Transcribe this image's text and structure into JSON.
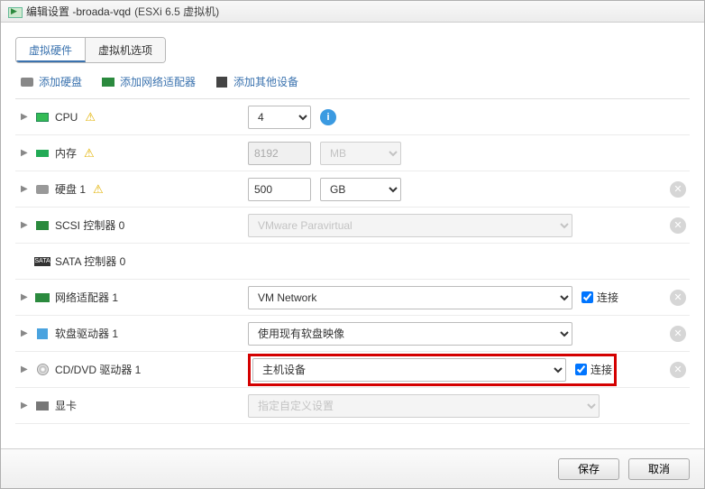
{
  "title": {
    "prefix": "编辑设置 - ",
    "vm": "broada-vqd",
    "suffix": "(ESXi 6.5 虚拟机)"
  },
  "tabs": {
    "hardware": "虚拟硬件",
    "options": "虚拟机选项"
  },
  "toolbar": {
    "add_disk": "添加硬盘",
    "add_nic": "添加网络适配器",
    "add_other": "添加其他设备"
  },
  "rows": {
    "cpu": {
      "label": "CPU",
      "value": "4"
    },
    "memory": {
      "label": "内存",
      "value": "8192",
      "unit": "MB"
    },
    "disk": {
      "label": "硬盘 1",
      "value": "500",
      "unit": "GB"
    },
    "scsi": {
      "label": "SCSI 控制器 0",
      "value": "VMware Paravirtual"
    },
    "sata": {
      "label": "SATA 控制器 0"
    },
    "nic": {
      "label": "网络适配器 1",
      "value": "VM Network",
      "connect": "连接"
    },
    "floppy": {
      "label": "软盘驱动器 1",
      "value": "使用现有软盘映像"
    },
    "cd": {
      "label": "CD/DVD 驱动器 1",
      "value": "主机设备",
      "connect": "连接"
    },
    "gpu": {
      "label": "显卡",
      "value": "指定自定义设置"
    }
  },
  "footer": {
    "save": "保存",
    "cancel": "取消"
  }
}
